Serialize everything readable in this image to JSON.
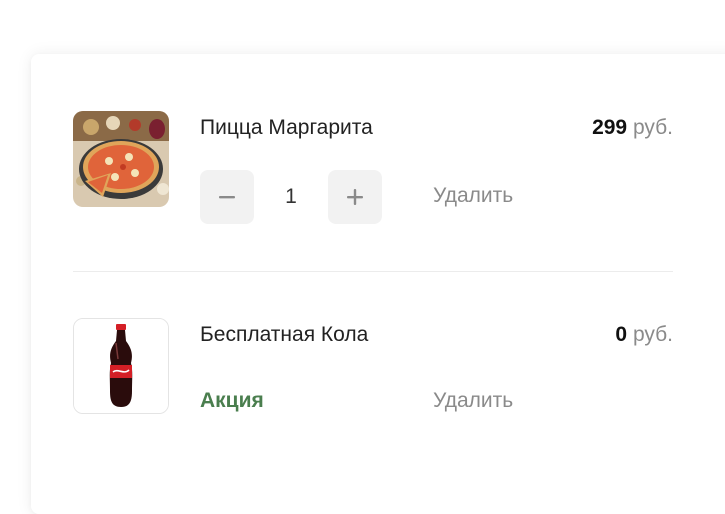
{
  "cart": {
    "items": [
      {
        "name": "Пицца Маргарита",
        "price_value": "299",
        "price_currency": "руб.",
        "quantity": "1",
        "remove_label": "Удалить",
        "image_icon": "pizza-image"
      },
      {
        "name": "Бесплатная Кола",
        "price_value": "0",
        "price_currency": "руб.",
        "promo_label": "Акция",
        "remove_label": "Удалить",
        "image_icon": "cola-bottle-image"
      }
    ]
  },
  "colors": {
    "promo": "#4a7e4e",
    "muted_text": "#8a8a8a",
    "stepper_bg": "#f2f2f2"
  }
}
